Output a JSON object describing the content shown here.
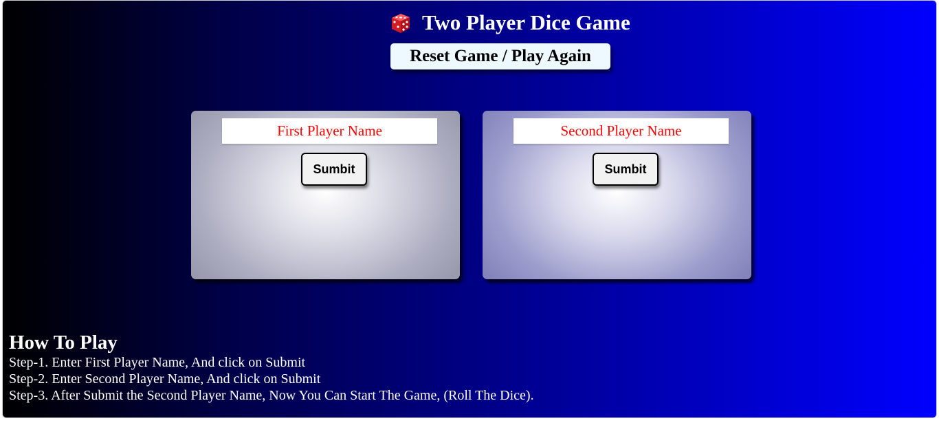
{
  "header": {
    "title": "Two Player Dice Game",
    "icon": "dice-icon",
    "reset_label": "Reset Game / Play Again"
  },
  "players": [
    {
      "placeholder": "First Player Name",
      "submit_label": "Sumbit"
    },
    {
      "placeholder": "Second Player Name",
      "submit_label": "Sumbit"
    }
  ],
  "how_to_play": {
    "title": "How To Play",
    "steps": [
      "Step-1. Enter First Player Name, And click on Submit",
      "Step-2. Enter Second Player Name, And click on Submit",
      "Step-3. After Submit the Second Player Name, Now You Can Start The Game, (Roll The Dice)."
    ]
  },
  "colors": {
    "background_start": "#000000",
    "background_end": "#0000ff",
    "dice": "#e0202a",
    "input_text": "#ff0000"
  }
}
